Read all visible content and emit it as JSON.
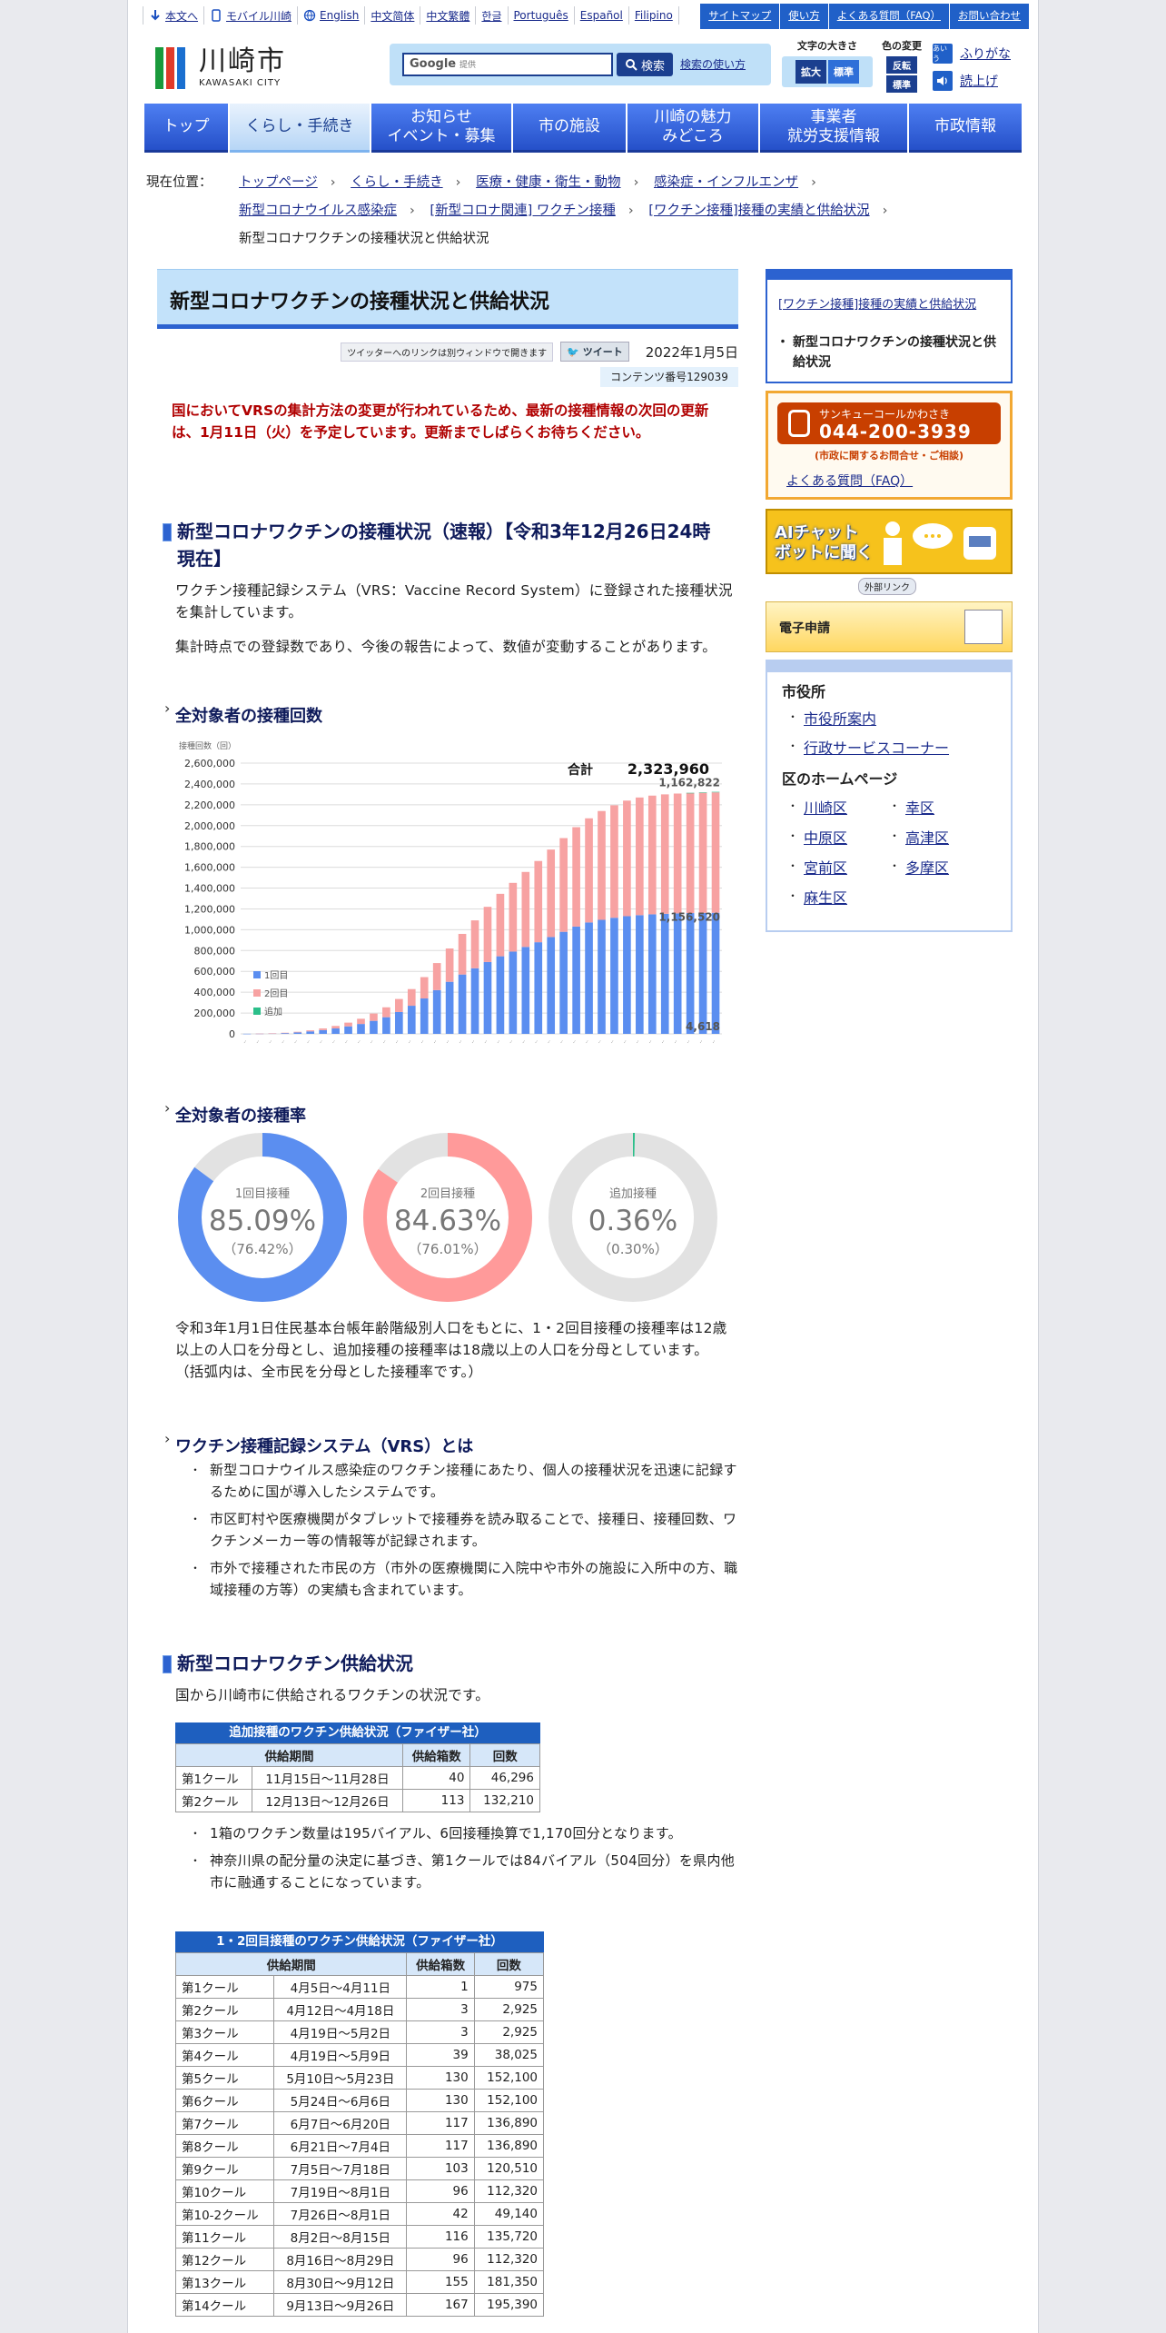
{
  "util": {
    "left": [
      "本文へ",
      "モバイル川崎",
      "English",
      "中文简体",
      "中文繁體",
      "한글",
      "Português",
      "Español",
      "Filipino"
    ],
    "right": [
      "サイトマップ",
      "使い方",
      "よくある質問（FAQ）",
      "お問い合わせ"
    ]
  },
  "header": {
    "logo_jp": "川崎市",
    "logo_en": "KAWASAKI CITY",
    "search_brand": "Google",
    "search_sub": "提供",
    "search_btn": "検索",
    "search_help": "検索の使い方",
    "textsize_label": "文字の大きさ",
    "textsize_big": "拡大",
    "textsize_std": "標準",
    "color_label": "色の変更",
    "color_rev": "反転",
    "color_std": "標準",
    "furigana": "ふりがな",
    "furigana_icon": "あいう",
    "yomiage": "読上げ"
  },
  "nav": [
    {
      "label": "トップ"
    },
    {
      "label": "くらし・手続き"
    },
    {
      "label": "お知らせ\nイベント・募集"
    },
    {
      "label": "市の施設"
    },
    {
      "label": "川崎の魅力\nみどころ"
    },
    {
      "label": "事業者\n就労支援情報"
    },
    {
      "label": "市政情報"
    }
  ],
  "breadcrumb": {
    "label": "現在位置：",
    "line1": [
      "トップページ",
      "くらし・手続き",
      "医療・健康・衛生・動物",
      "感染症・インフルエンザ"
    ],
    "line2": [
      "新型コロナウイルス感染症",
      "[新型コロナ関連] ワクチン接種",
      "[ワクチン接種]接種の実績と供給状況"
    ],
    "current": "新型コロナワクチンの接種状況と供給状況"
  },
  "page": {
    "title": "新型コロナワクチンの接種状況と供給状況",
    "twitter_note": "ツイッターへのリンクは別ウィンドウで開きます",
    "tweet": "ツイート",
    "date": "2022年1月5日",
    "content_no": "コンテンツ番号129039",
    "notice": "国においてVRSの集計方法の変更が行われているため、最新の接種情報の次回の更新は、1月11日（火）を予定しています。更新までしばらくお待ちください。"
  },
  "section1": {
    "title": "新型コロナワクチンの接種状況（速報）【令和3年12月26日24時現在】",
    "p1": "ワクチン接種記録システム（VRS：Vaccine Record System）に登録された接種状況を集計しています。",
    "p2": "集計時点での登録数であり、今後の報告によって、数値が変動することがあります。",
    "h3_count": "全対象者の接種回数",
    "h3_rate": "全対象者の接種率",
    "rate_note": "令和3年1月1日住民基本台帳年齢階級別人口をもとに、1・2回目接種の接種率は12歳以上の人口を分母とし、追加接種の接種率は18歳以上の人口を分母としています。\n（括弧内は、全市民を分母とした接種率です。）",
    "h3_vrs": "ワクチン接種記録システム（VRS）とは",
    "vrs_items": [
      "新型コロナウイルス感染症のワクチン接種にあたり、個人の接種状況を迅速に記録するために国が導入したシステムです。",
      "市区町村や医療機関がタブレットで接種券を読み取ることで、接種日、接種回数、ワクチンメーカー等の情報等が記録されます。",
      "市外で接種された市民の方（市外の医療機関に入院中や市外の施設に入所中の方、職域接種の方等）の実績も含まれています。"
    ]
  },
  "chart_data": {
    "type": "bar",
    "ylabel": "接種回数（回）",
    "ylim": [
      0,
      2600000
    ],
    "yticks": [
      "2,600,000",
      "2,400,000",
      "2,200,000",
      "2,000,000",
      "1,800,000",
      "1,600,000",
      "1,400,000",
      "1,200,000",
      "1,000,000",
      "800,000",
      "600,000",
      "400,000",
      "200,000",
      "0"
    ],
    "total_label": "合計",
    "total_value": "2,323,960",
    "label_first": "1,162,822",
    "label_second": "1,156,520",
    "label_booster": "4,618",
    "series": [
      {
        "name": "1回目",
        "color": "#5b8ef0",
        "values": [
          1000,
          2000,
          4000,
          8000,
          14000,
          24000,
          36000,
          52000,
          72000,
          95000,
          125000,
          160000,
          210000,
          270000,
          340000,
          420000,
          500000,
          570000,
          630000,
          690000,
          745000,
          790000,
          835000,
          880000,
          930000,
          980000,
          1030000,
          1070000,
          1095000,
          1115000,
          1130000,
          1140000,
          1148000,
          1153000,
          1157000,
          1160000,
          1161500,
          1162822
        ]
      },
      {
        "name": "2回目",
        "color": "#f7a2a2",
        "values": [
          0,
          500,
          1500,
          3000,
          6000,
          10000,
          16000,
          24000,
          36000,
          50000,
          70000,
          95000,
          125000,
          160000,
          205000,
          260000,
          320000,
          390000,
          460000,
          530000,
          600000,
          660000,
          720000,
          780000,
          840000,
          900000,
          955000,
          1000000,
          1045000,
          1080000,
          1110000,
          1130000,
          1140000,
          1147000,
          1151000,
          1154000,
          1155500,
          1156520
        ]
      },
      {
        "name": "追加",
        "color": "#2bbf8a",
        "values": [
          0,
          0,
          0,
          0,
          0,
          0,
          0,
          0,
          0,
          0,
          0,
          0,
          0,
          0,
          0,
          0,
          0,
          0,
          0,
          0,
          0,
          0,
          0,
          0,
          0,
          0,
          0,
          0,
          0,
          0,
          0,
          0,
          0,
          0,
          0,
          200,
          1500,
          4618
        ]
      }
    ]
  },
  "donuts": [
    {
      "label": "1回目接種",
      "value": 85.09,
      "value_text": "85.09%",
      "sub": "（76.42%）",
      "color": "#5b8ef0"
    },
    {
      "label": "2回目接種",
      "value": 84.63,
      "value_text": "84.63%",
      "sub": "（76.01%）",
      "color": "#ff9a9a"
    },
    {
      "label": "追加接種",
      "value": 0.36,
      "value_text": "0.36%",
      "sub": "（0.30%）",
      "color": "#2bbf8a"
    }
  ],
  "supply": {
    "title": "新型コロナワクチン供給状況",
    "intro": "国から川崎市に供給されるワクチンの状況です。",
    "t1_caption": "追加接種のワクチン供給状況（ファイザー社）",
    "headers": [
      "供給期間",
      "供給箱数",
      "回数"
    ],
    "t1_rows": [
      [
        "第1クール",
        "11月15日～11月28日",
        "40",
        "46,296"
      ],
      [
        "第2クール",
        "12月13日～12月26日",
        "113",
        "132,210"
      ]
    ],
    "notes": [
      "1箱のワクチン数量は195バイアル、6回接種換算で1,170回分となります。",
      "神奈川県の配分量の決定に基づき、第1クールでは84バイアル（504回分）を県内他市に融通することになっています。"
    ],
    "t2_caption": "1・2回目接種のワクチン供給状況（ファイザー社）",
    "t2_rows": [
      [
        "第1クール",
        "4月5日～4月11日",
        "1",
        "975"
      ],
      [
        "第2クール",
        "4月12日～4月18日",
        "3",
        "2,925"
      ],
      [
        "第3クール",
        "4月19日～5月2日",
        "3",
        "2,925"
      ],
      [
        "第4クール",
        "4月19日～5月9日",
        "39",
        "38,025"
      ],
      [
        "第5クール",
        "5月10日～5月23日",
        "130",
        "152,100"
      ],
      [
        "第6クール",
        "5月24日～6月6日",
        "130",
        "152,100"
      ],
      [
        "第7クール",
        "6月7日～6月20日",
        "117",
        "136,890"
      ],
      [
        "第8クール",
        "6月21日～7月4日",
        "117",
        "136,890"
      ],
      [
        "第9クール",
        "7月5日～7月18日",
        "103",
        "120,510"
      ],
      [
        "第10クール",
        "7月19日～8月1日",
        "96",
        "112,320"
      ],
      [
        "第10-2クール",
        "7月26日～8月1日",
        "42",
        "49,140"
      ],
      [
        "第11クール",
        "8月2日～8月15日",
        "116",
        "135,720"
      ],
      [
        "第12クール",
        "8月16日～8月29日",
        "96",
        "112,320"
      ],
      [
        "第13クール",
        "8月30日～9月12日",
        "155",
        "181,350"
      ],
      [
        "第14クール",
        "9月13日～9月26日",
        "167",
        "195,390"
      ]
    ]
  },
  "sidebar": {
    "parent_link": "[ワクチン接種]接種の実績と供給状況",
    "current": "新型コロナワクチンの接種状況と供給状況",
    "call_name": "サンキューコールかわさき",
    "call_number": "044-200-3939",
    "call_sub": "(市政に関するお問合せ・ご相談)",
    "faq": "よくある質問（FAQ）",
    "ai_chat": "AIチャット\nボットに聞く",
    "external": "外部リンク",
    "e_app": "電子申請",
    "city_hall": "市役所",
    "city_links": [
      "市役所案内",
      "行政サービスコーナー"
    ],
    "ward_heading": "区のホームページ",
    "wards": [
      "川崎区",
      "幸区",
      "中原区",
      "高津区",
      "宮前区",
      "多摩区",
      "麻生区"
    ],
    "colors": {
      "accent": "#2c62d0",
      "call": "#c83f00",
      "ai": "#f6c21c"
    }
  }
}
